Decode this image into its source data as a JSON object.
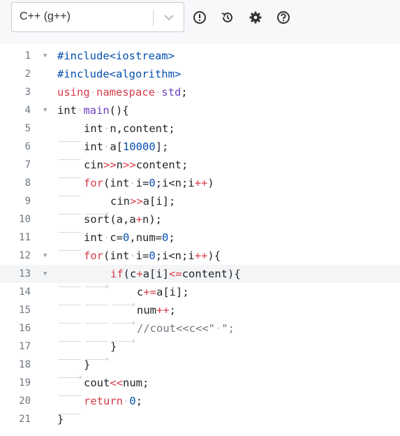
{
  "toolbar": {
    "language": "C++ (g++)",
    "icons": [
      "chevron-down-icon",
      "info-icon",
      "history-icon",
      "settings-icon",
      "help-icon"
    ]
  },
  "editor": {
    "lines": [
      {
        "n": "1",
        "tokens": [
          [
            "pp",
            "#include<iostream>"
          ]
        ]
      },
      {
        "n": "2",
        "tokens": [
          [
            "pp",
            "#include<algorithm>"
          ]
        ]
      },
      {
        "n": "3",
        "tokens": [
          [
            "kw",
            "using"
          ],
          [
            "sp",
            "·"
          ],
          [
            "kw",
            "namespace"
          ],
          [
            "sp",
            "·"
          ],
          [
            "fn",
            "std"
          ],
          [
            "ty",
            ";"
          ]
        ]
      },
      {
        "n": "4",
        "tokens": [
          [
            "ty",
            "int"
          ],
          [
            "sp",
            "·"
          ],
          [
            "fn",
            "main"
          ],
          [
            "ty",
            "(){"
          ]
        ]
      },
      {
        "n": "5",
        "tokens": [
          [
            "tab",
            ""
          ],
          [
            "ty",
            "int"
          ],
          [
            "sp",
            "·"
          ],
          [
            "ty",
            "n,content;"
          ]
        ]
      },
      {
        "n": "6",
        "tokens": [
          [
            "tab",
            ""
          ],
          [
            "ty",
            "int"
          ],
          [
            "sp",
            "·"
          ],
          [
            "ty",
            "a["
          ],
          [
            "nm",
            "10000"
          ],
          [
            "ty",
            "];"
          ]
        ]
      },
      {
        "n": "7",
        "tokens": [
          [
            "tab",
            ""
          ],
          [
            "ty",
            "cin"
          ],
          [
            "op",
            ">>"
          ],
          [
            "ty",
            "n"
          ],
          [
            "op",
            ">>"
          ],
          [
            "ty",
            "content;"
          ]
        ]
      },
      {
        "n": "8",
        "tokens": [
          [
            "tab",
            ""
          ],
          [
            "kw",
            "for"
          ],
          [
            "ty",
            "(int"
          ],
          [
            "sp",
            "·"
          ],
          [
            "ty",
            "i="
          ],
          [
            "nm",
            "0"
          ],
          [
            "ty",
            ";i<n;i"
          ],
          [
            "op",
            "++"
          ],
          [
            "ty",
            ")"
          ]
        ]
      },
      {
        "n": "9",
        "tokens": [
          [
            "tab",
            ""
          ],
          [
            "tabarrow",
            ""
          ],
          [
            "ty",
            "cin"
          ],
          [
            "op",
            ">>"
          ],
          [
            "ty",
            "a[i];"
          ]
        ]
      },
      {
        "n": "10",
        "tokens": [
          [
            "tab",
            ""
          ],
          [
            "ty",
            "sort(a,a"
          ],
          [
            "op",
            "+"
          ],
          [
            "ty",
            "n);"
          ]
        ]
      },
      {
        "n": "11",
        "tokens": [
          [
            "tab",
            ""
          ],
          [
            "ty",
            "int"
          ],
          [
            "sp",
            "·"
          ],
          [
            "ty",
            "c="
          ],
          [
            "nm",
            "0"
          ],
          [
            "ty",
            ",num="
          ],
          [
            "nm",
            "0"
          ],
          [
            "ty",
            ";"
          ]
        ]
      },
      {
        "n": "12",
        "tokens": [
          [
            "tab",
            ""
          ],
          [
            "kw",
            "for"
          ],
          [
            "ty",
            "(int"
          ],
          [
            "sp",
            "·"
          ],
          [
            "ty",
            "i="
          ],
          [
            "nm",
            "0"
          ],
          [
            "ty",
            ";i<n;i"
          ],
          [
            "op",
            "++"
          ],
          [
            "ty",
            "){"
          ]
        ]
      },
      {
        "n": "13",
        "tokens": [
          [
            "tab",
            ""
          ],
          [
            "tabarrow",
            ""
          ],
          [
            "kw",
            "if"
          ],
          [
            "ty",
            "(c"
          ],
          [
            "op",
            "+"
          ],
          [
            "ty",
            "a[i]"
          ],
          [
            "op",
            "<="
          ],
          [
            "ty",
            "content){"
          ]
        ]
      },
      {
        "n": "14",
        "tokens": [
          [
            "tab",
            ""
          ],
          [
            "tab",
            ""
          ],
          [
            "tabarrow",
            ""
          ],
          [
            "ty",
            "c"
          ],
          [
            "op",
            "+="
          ],
          [
            "ty",
            "a[i];"
          ]
        ]
      },
      {
        "n": "15",
        "tokens": [
          [
            "tab",
            ""
          ],
          [
            "tab",
            ""
          ],
          [
            "tabarrow",
            ""
          ],
          [
            "ty",
            "num"
          ],
          [
            "op",
            "++"
          ],
          [
            "ty",
            ";"
          ]
        ]
      },
      {
        "n": "16",
        "tokens": [
          [
            "tab",
            ""
          ],
          [
            "tab",
            ""
          ],
          [
            "tabarrow",
            ""
          ],
          [
            "cm",
            "//cout<<c<<\""
          ],
          [
            "sp",
            "·"
          ],
          [
            "cm",
            "\";"
          ]
        ]
      },
      {
        "n": "17",
        "tokens": [
          [
            "tab",
            ""
          ],
          [
            "tabarrow",
            ""
          ],
          [
            "ty",
            "}"
          ]
        ]
      },
      {
        "n": "18",
        "tokens": [
          [
            "tabarrow",
            ""
          ],
          [
            "ty",
            "}"
          ]
        ]
      },
      {
        "n": "19",
        "tokens": [
          [
            "tab",
            ""
          ],
          [
            "ty",
            "cout"
          ],
          [
            "op",
            "<<"
          ],
          [
            "ty",
            "num;"
          ]
        ]
      },
      {
        "n": "20",
        "tokens": [
          [
            "tab",
            ""
          ],
          [
            "kw",
            "return"
          ],
          [
            "sp",
            "·"
          ],
          [
            "nm",
            "0"
          ],
          [
            "ty",
            ";"
          ]
        ]
      },
      {
        "n": "21",
        "tokens": [
          [
            "ty",
            "}"
          ]
        ]
      }
    ],
    "fold_lines": [
      "1",
      "4",
      "12",
      "13"
    ],
    "active_line": "13"
  }
}
